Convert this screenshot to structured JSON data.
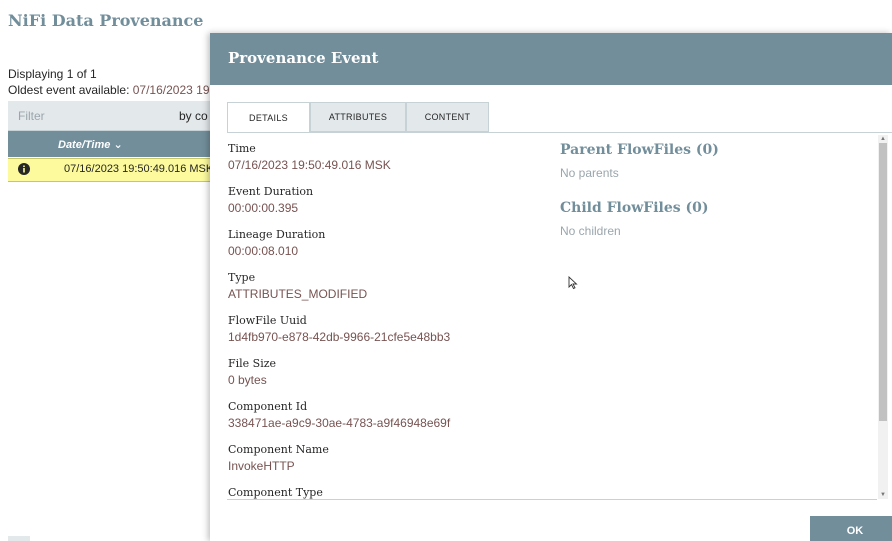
{
  "page": {
    "title": "NiFi Data Provenance",
    "displaying": "Displaying 1 of 1",
    "oldest_label": "Oldest event available: ",
    "oldest_value": "07/16/2023 19",
    "filter": {
      "placeholder": "Filter",
      "by_label": "by co"
    },
    "table": {
      "header": "Date/Time",
      "sort_icon": "sort-desc-icon",
      "rows": [
        {
          "icon": "info-icon",
          "datetime": "07/16/2023 19:50:49.016 MSK"
        }
      ]
    }
  },
  "dialog": {
    "title": "Provenance Event",
    "tabs": [
      "DETAILS",
      "ATTRIBUTES",
      "CONTENT"
    ],
    "active_tab": "DETAILS",
    "fields": [
      {
        "label": "Time",
        "value": "07/16/2023 19:50:49.016 MSK"
      },
      {
        "label": "Event Duration",
        "value": "00:00:00.395"
      },
      {
        "label": "Lineage Duration",
        "value": "00:00:08.010"
      },
      {
        "label": "Type",
        "value": "ATTRIBUTES_MODIFIED"
      },
      {
        "label": "FlowFile Uuid",
        "value": "1d4fb970-e878-42db-9966-21cfe5e48bb3"
      },
      {
        "label": "File Size",
        "value": "0 bytes"
      },
      {
        "label": "Component Id",
        "value": "338471ae-a9c9-30ae-4783-a9f46948e69f"
      },
      {
        "label": "Component Name",
        "value": "InvokeHTTP"
      },
      {
        "label": "Component Type",
        "value": ""
      }
    ],
    "parent": {
      "title": "Parent FlowFiles",
      "count": "(0)",
      "empty": "No parents"
    },
    "child": {
      "title": "Child FlowFiles",
      "count": "(0)",
      "empty": "No children"
    },
    "ok_label": "OK"
  },
  "colors": {
    "accent": "#728e9b",
    "value_text": "#775351",
    "highlight_row": "#fcfa9d"
  }
}
